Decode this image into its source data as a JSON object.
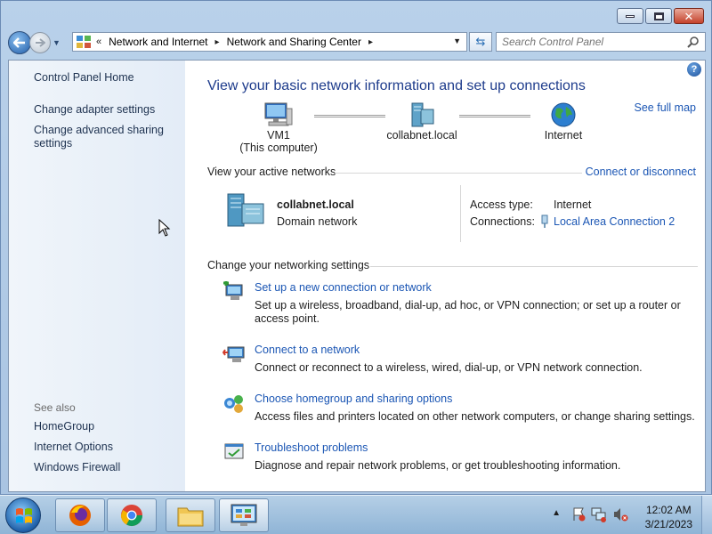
{
  "address_bar": {
    "overflow": "«",
    "crumbs": [
      "Network and Internet",
      "Network and Sharing Center"
    ]
  },
  "search": {
    "placeholder": "Search Control Panel"
  },
  "sidebar": {
    "home": "Control Panel Home",
    "links": [
      "Change adapter settings",
      "Change advanced sharing settings"
    ],
    "see_also_label": "See also",
    "see_also": [
      "HomeGroup",
      "Internet Options",
      "Windows Firewall"
    ]
  },
  "main": {
    "heading": "View your basic network information and set up connections",
    "see_full_map": "See full map",
    "map": {
      "computer_name": "VM1",
      "computer_sub": "(This computer)",
      "network": "collabnet.local",
      "internet": "Internet"
    },
    "active_networks": {
      "title": "View your active networks",
      "connect_link": "Connect or disconnect",
      "network_name": "collabnet.local",
      "network_type": "Domain network",
      "access_type_label": "Access type:",
      "access_type_value": "Internet",
      "connections_label": "Connections:",
      "connections_value": "Local Area Connection 2"
    },
    "settings": {
      "title": "Change your networking settings",
      "tasks": [
        {
          "title": "Set up a new connection or network",
          "desc": "Set up a wireless, broadband, dial-up, ad hoc, or VPN connection; or set up a router or access point."
        },
        {
          "title": "Connect to a network",
          "desc": "Connect or reconnect to a wireless, wired, dial-up, or VPN network connection."
        },
        {
          "title": "Choose homegroup and sharing options",
          "desc": "Access files and printers located on other network computers, or change sharing settings."
        },
        {
          "title": "Troubleshoot problems",
          "desc": "Diagnose and repair network problems, or get troubleshooting information."
        }
      ]
    }
  },
  "taskbar": {
    "time": "12:02 AM",
    "date": "3/21/2023"
  },
  "colors": {
    "link": "#1b56b4",
    "heading": "#1e3c8c"
  }
}
